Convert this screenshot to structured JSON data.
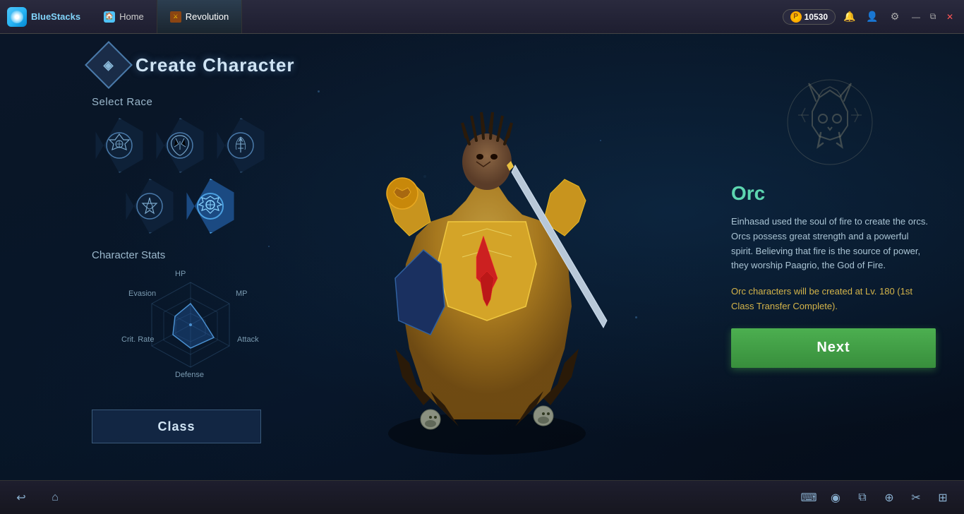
{
  "titlebar": {
    "brand": "BlueStacks",
    "coin_label": "P",
    "coin_amount": "10530",
    "tabs": [
      {
        "id": "home",
        "label": "Home",
        "active": false
      },
      {
        "id": "revolution",
        "label": "Revolution",
        "active": true
      }
    ]
  },
  "page": {
    "title": "Create Character",
    "select_race_label": "Select Race",
    "character_stats_label": "Character Stats",
    "class_btn_label": "Class",
    "next_btn_label": "Next"
  },
  "races": [
    {
      "id": "race1",
      "symbol": "✦",
      "selected": false,
      "row": 0
    },
    {
      "id": "race2",
      "symbol": "☽",
      "selected": false,
      "row": 0
    },
    {
      "id": "race3",
      "symbol": "✤",
      "selected": false,
      "row": 0
    },
    {
      "id": "race4",
      "symbol": "⚜",
      "selected": false,
      "row": 1
    },
    {
      "id": "race5",
      "symbol": "❖",
      "selected": true,
      "row": 1
    }
  ],
  "stats": {
    "labels": [
      "HP",
      "MP",
      "Attack",
      "Defense",
      "Crit. Rate",
      "Evasion"
    ],
    "values": [
      0.5,
      0.3,
      0.6,
      0.55,
      0.45,
      0.4
    ]
  },
  "race_info": {
    "name": "Orc",
    "description": "Einhasad used the soul of fire to create the orcs. Orcs possess great strength and a powerful spirit. Believing that fire is the source of power, they worship Paagrio, the God of Fire.",
    "note": "Orc characters will be created at Lv. 180 (1st Class Transfer Complete)."
  },
  "taskbar": {
    "icons_left": [
      "↩",
      "⌂"
    ],
    "icons_right": [
      "⌨",
      "◉",
      "⧉",
      "⊕",
      "✂",
      "⊞"
    ]
  }
}
